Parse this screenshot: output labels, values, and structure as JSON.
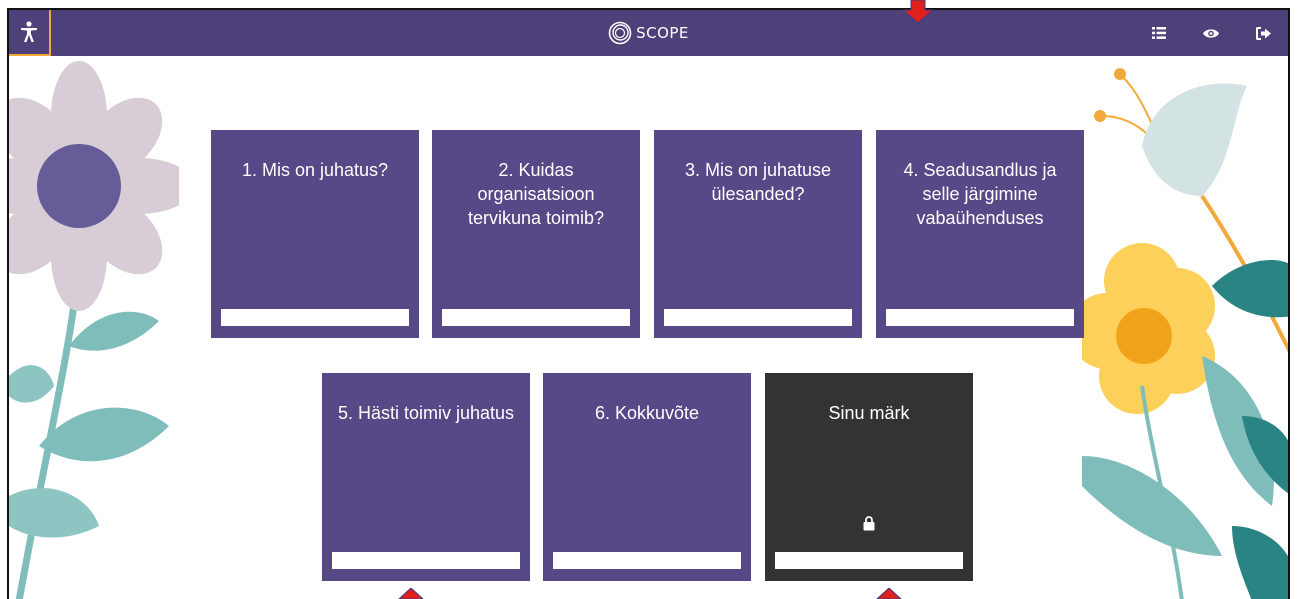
{
  "topbar": {
    "logo_text": "SCOPE",
    "bg_color": "#4e4079",
    "icons": [
      "accessibility-icon",
      "list-icon",
      "eye-icon",
      "logout-icon"
    ]
  },
  "tiles": [
    {
      "title": "1. Mis on juhatus?",
      "locked": false
    },
    {
      "title": "2. Kuidas organisatsioon tervikuna toimib?",
      "locked": false
    },
    {
      "title": "3. Mis on juhatuse ülesanded?",
      "locked": false
    },
    {
      "title": "4. Seadusandlus ja selle järgimine vabaühenduses",
      "locked": false
    },
    {
      "title": "5. Hästi toimiv juhatus",
      "locked": false
    },
    {
      "title": "6. Kokkuvõte",
      "locked": false
    },
    {
      "title": "Sinu märk",
      "locked": true
    }
  ],
  "colors": {
    "tile": "#574887",
    "tile_locked": "#333333",
    "accent": "#f2a93b",
    "marker": "#e0201b"
  }
}
